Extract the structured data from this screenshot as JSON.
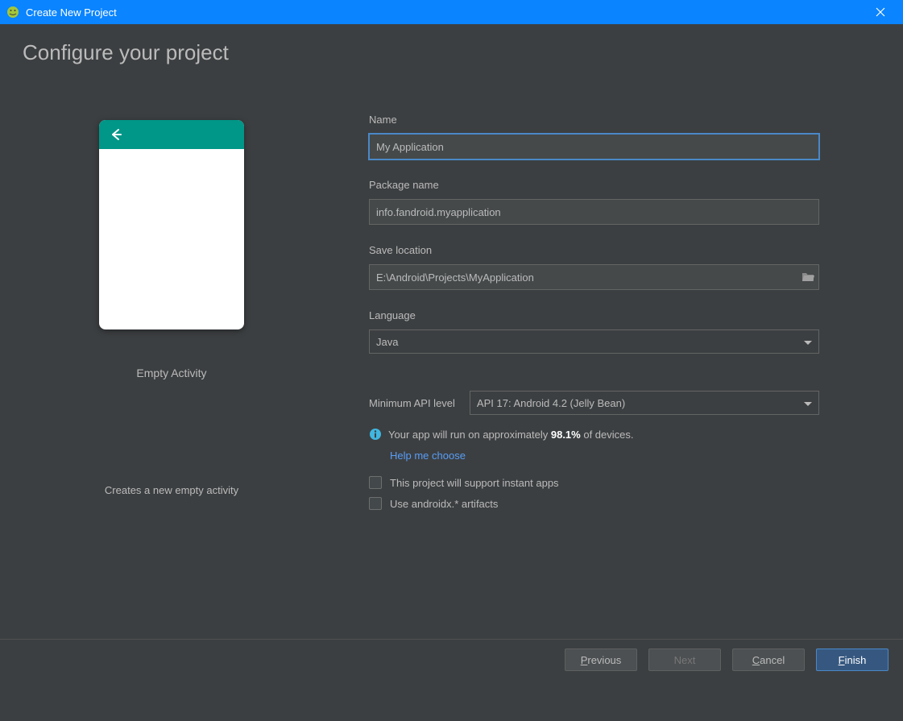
{
  "window": {
    "title": "Create New Project"
  },
  "page": {
    "heading": "Configure your project"
  },
  "preview": {
    "label": "Empty Activity",
    "description": "Creates a new empty activity"
  },
  "form": {
    "name_label": "Name",
    "name_value": "My Application",
    "package_label": "Package name",
    "package_value": "info.fandroid.myapplication",
    "location_label": "Save location",
    "location_value": "E:\\Android\\Projects\\MyApplication",
    "language_label": "Language",
    "language_value": "Java",
    "api_label": "Minimum API level",
    "api_value": "API 17: Android 4.2 (Jelly Bean)",
    "info_prefix": "Your app will run on approximately ",
    "info_pct": "98.1%",
    "info_suffix": " of devices.",
    "help_link": "Help me choose",
    "instant_apps_label": "This project will support instant apps",
    "androidx_label": "Use androidx.* artifacts"
  },
  "buttons": {
    "previous": "revious",
    "previous_u": "P",
    "next": "Next",
    "cancel": "ancel",
    "cancel_u": "C",
    "finish": "inish",
    "finish_u": "F"
  }
}
